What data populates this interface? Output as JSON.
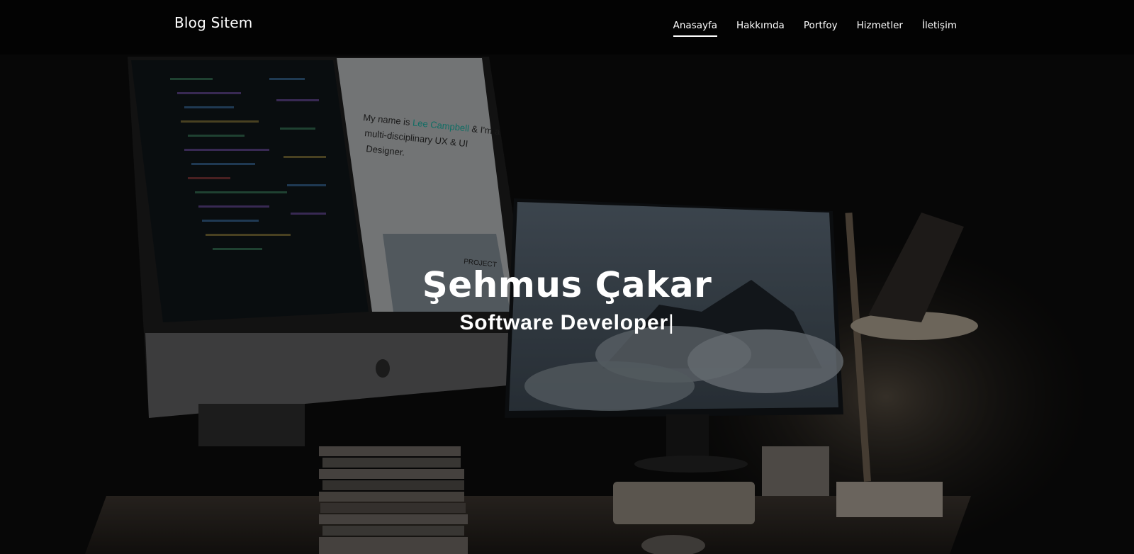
{
  "brand": {
    "title": "Blog Sitem"
  },
  "nav": {
    "items": [
      {
        "label": "Anasayfa",
        "active": true
      },
      {
        "label": "Hakkımda",
        "active": false
      },
      {
        "label": "Portfoy",
        "active": false
      },
      {
        "label": "Hizmetler",
        "active": false
      },
      {
        "label": "İletişim",
        "active": false
      }
    ]
  },
  "hero": {
    "name": "Şehmus Çakar",
    "role": "Software Developer",
    "cursor": "|",
    "monitor_heading_prefix": "My name is ",
    "monitor_heading_name": "Lee Campbell",
    "monitor_heading_suffix": " & I'm a",
    "monitor_heading_line2": "multi-disciplinary UX & UI",
    "monitor_heading_line3": "Designer.",
    "monitor_project_label": "PROJECT"
  },
  "colors": {
    "navbar_bg": "#030303",
    "text": "#ffffff",
    "accent": "#1aa89a"
  }
}
